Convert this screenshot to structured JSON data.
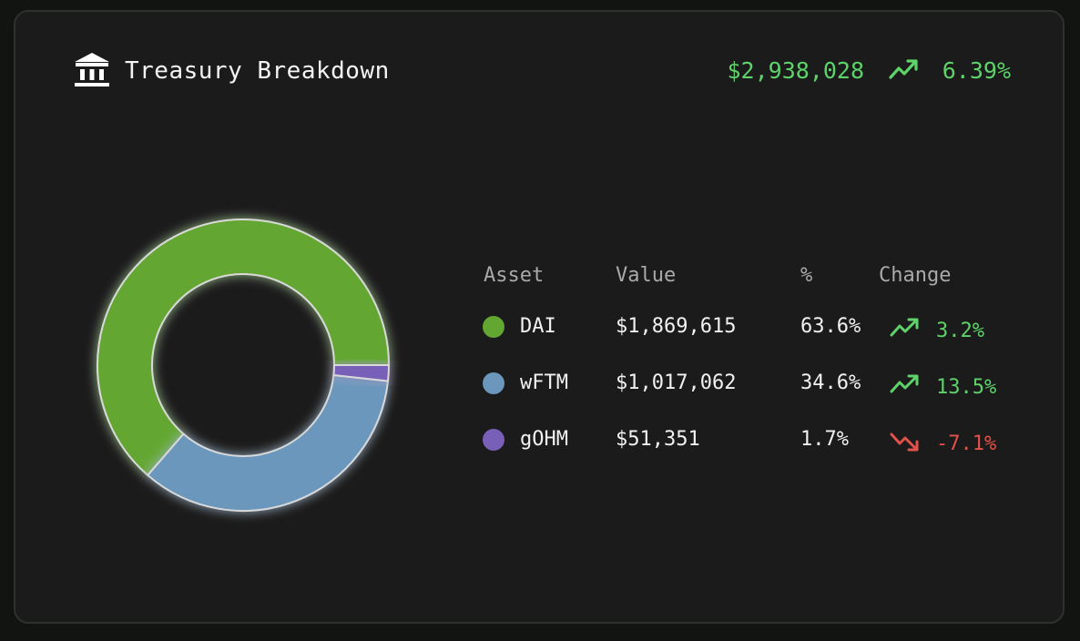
{
  "header": {
    "icon": "bank-icon",
    "title": "Treasury Breakdown",
    "total_value": "$2,938,028",
    "total_trend_icon": "trending-up-icon",
    "total_change": "6.39%"
  },
  "colors": {
    "positive": "#5dd36a",
    "negative": "#e0524a",
    "card_bg": "#1b1b1b",
    "header_text": "#a9a9a9"
  },
  "table": {
    "headers": {
      "asset": "Asset",
      "value": "Value",
      "percent": "%",
      "change": "Change"
    },
    "rows": [
      {
        "asset": "DAI",
        "value": "$1,869,615",
        "percent": "63.6%",
        "change": "3.2%",
        "trend_icon": "trending-up-icon",
        "direction": "up",
        "color": "#63a733"
      },
      {
        "asset": "wFTM",
        "value": "$1,017,062",
        "percent": "34.6%",
        "change": "13.5%",
        "trend_icon": "trending-up-icon",
        "direction": "up",
        "color": "#6a97bb"
      },
      {
        "asset": "gOHM",
        "value": "$51,351",
        "percent": "1.7%",
        "change": "-7.1%",
        "trend_icon": "trending-down-icon",
        "direction": "down",
        "color": "#7860b9"
      }
    ]
  },
  "chart_data": {
    "type": "pie",
    "variant": "donut",
    "categories": [
      "DAI",
      "wFTM",
      "gOHM"
    ],
    "values": [
      1869615,
      1017062,
      51351
    ],
    "percentages": [
      63.6,
      34.6,
      1.7
    ],
    "colors": [
      "#63a733",
      "#6a97bb",
      "#7860b9"
    ],
    "title": "",
    "legend": "table-right"
  }
}
